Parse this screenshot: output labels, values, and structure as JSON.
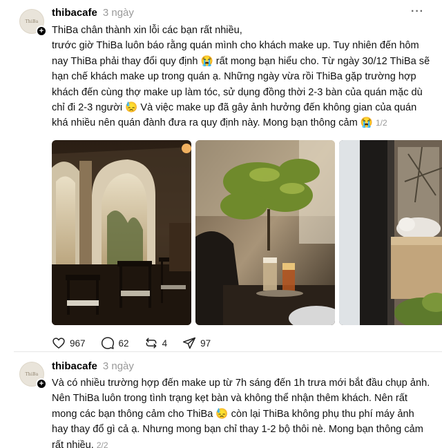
{
  "posts": [
    {
      "username": "thibacafe",
      "time": "3 ngày",
      "avatar_text": "ThiBa",
      "text": "ThiBa chân thành xin lỗi các bạn rất nhiều,\ntrước giờ ThiBa luôn báo rằng quán mình cho khách make up. Tuy nhiên đến hôm nay ThiBa phải thay đổi quy định 😭 rất mong bạn hiểu cho. Từ ngày 30/12 ThiBa sẽ hạn chế khách make up trong quán ạ. Những ngày vừa rồi ThiBa gặp trường hợp khách đến cùng thợ make up làm tóc, sử dụng đồng thời 2-3 bàn của quán mặc dù chỉ đi 2-3 người 😓 Và việc make up đã gây ảnh hưởng đến không gian của quán khá nhiều nên quán đành đưa ra quy định này. Mong bạn thông cảm 😭",
      "pager": "1/2",
      "likes": "967",
      "comments": "62",
      "reposts": "4",
      "shares": "97"
    },
    {
      "username": "thibacafe",
      "time": "3 ngày",
      "avatar_text": "ThiBa",
      "text": "Và có nhiều trường hợp đến make up từ 7h sáng đến 1h trưa mới bắt đầu chụp ảnh. Nên ThiBa luôn trong tình trạng kẹt bàn và không thể nhận thêm khách. Nên rất mong các bạn thông cảm cho ThiBa 😓 còn lại ThiBa không phụ thu phí máy ảnh hay thay đổ gì cả ạ. Nhưng mong bạn chỉ thay 1-2 bộ thôi nè. Mong bạn thông cảm rất nhiều.",
      "pager": "2/2"
    }
  ],
  "icons": {
    "more": "more-dots-icon",
    "like": "heart-icon",
    "comment": "comment-icon",
    "repost": "repost-icon",
    "share": "share-icon",
    "follow": "plus-icon"
  }
}
